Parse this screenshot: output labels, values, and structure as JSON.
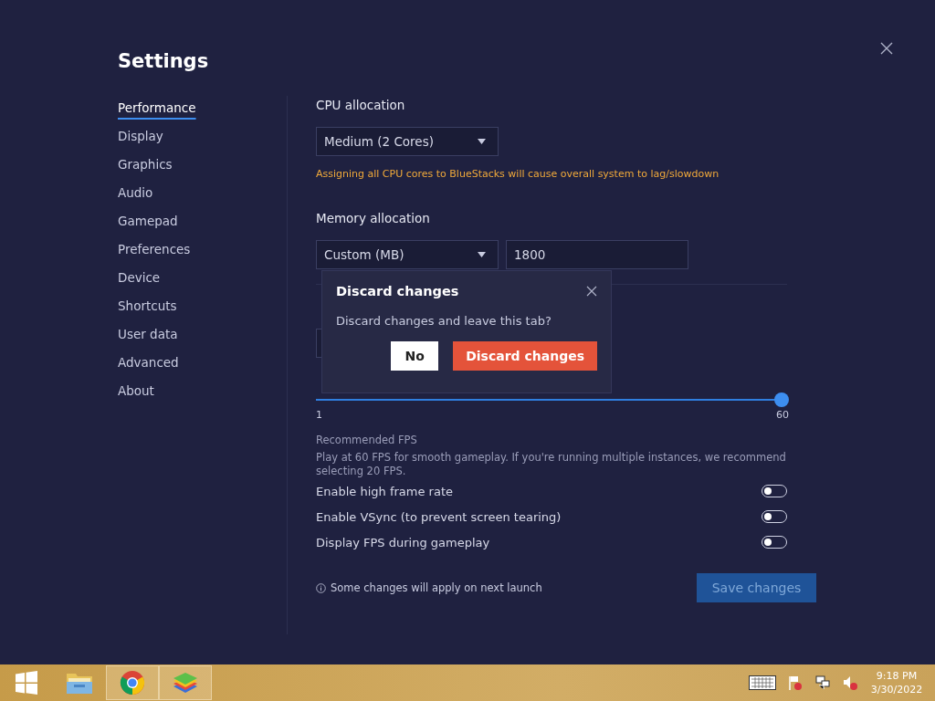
{
  "settings": {
    "title": "Settings",
    "sidebar": {
      "items": [
        {
          "label": "Performance",
          "selected": true
        },
        {
          "label": "Display",
          "selected": false
        },
        {
          "label": "Graphics",
          "selected": false
        },
        {
          "label": "Audio",
          "selected": false
        },
        {
          "label": "Gamepad",
          "selected": false
        },
        {
          "label": "Preferences",
          "selected": false
        },
        {
          "label": "Device",
          "selected": false
        },
        {
          "label": "Shortcuts",
          "selected": false
        },
        {
          "label": "User data",
          "selected": false
        },
        {
          "label": "Advanced",
          "selected": false
        },
        {
          "label": "About",
          "selected": false
        }
      ]
    },
    "cpu": {
      "label": "CPU allocation",
      "value": "Medium (2 Cores)",
      "warning": "Assigning all CPU cores to BlueStacks will cause overall system to lag/slowdown"
    },
    "memory": {
      "label": "Memory allocation",
      "value": "Custom (MB)",
      "amount": "1800"
    },
    "frame_rate": {
      "level": 1.0,
      "min": "1",
      "max": "60"
    },
    "recommended": {
      "title": "Recommended FPS",
      "text": "Play at 60 FPS for smooth gameplay. If you're running multiple instances, we recommend selecting 20 FPS."
    },
    "toggles": [
      {
        "label": "Enable high frame rate",
        "on": false
      },
      {
        "label": "Enable VSync (to prevent screen tearing)",
        "on": false
      },
      {
        "label": "Display FPS during gameplay",
        "on": false
      }
    ],
    "note": "Some changes will apply on next launch",
    "save_button": {
      "label": "Save changes",
      "disabled": true
    }
  },
  "dialog": {
    "title": "Discard changes",
    "message": "Discard changes and leave this tab?",
    "buttons": [
      {
        "label": "No",
        "kind": "secondary"
      },
      {
        "label": "Discard changes",
        "kind": "danger"
      }
    ]
  },
  "taskbar": {
    "apps": [
      {
        "kind": "folder",
        "active": false
      },
      {
        "kind": "browser",
        "active": true
      },
      {
        "kind": "stack",
        "active": true
      }
    ],
    "time": "9:18 PM",
    "date": "3/30/2022"
  }
}
